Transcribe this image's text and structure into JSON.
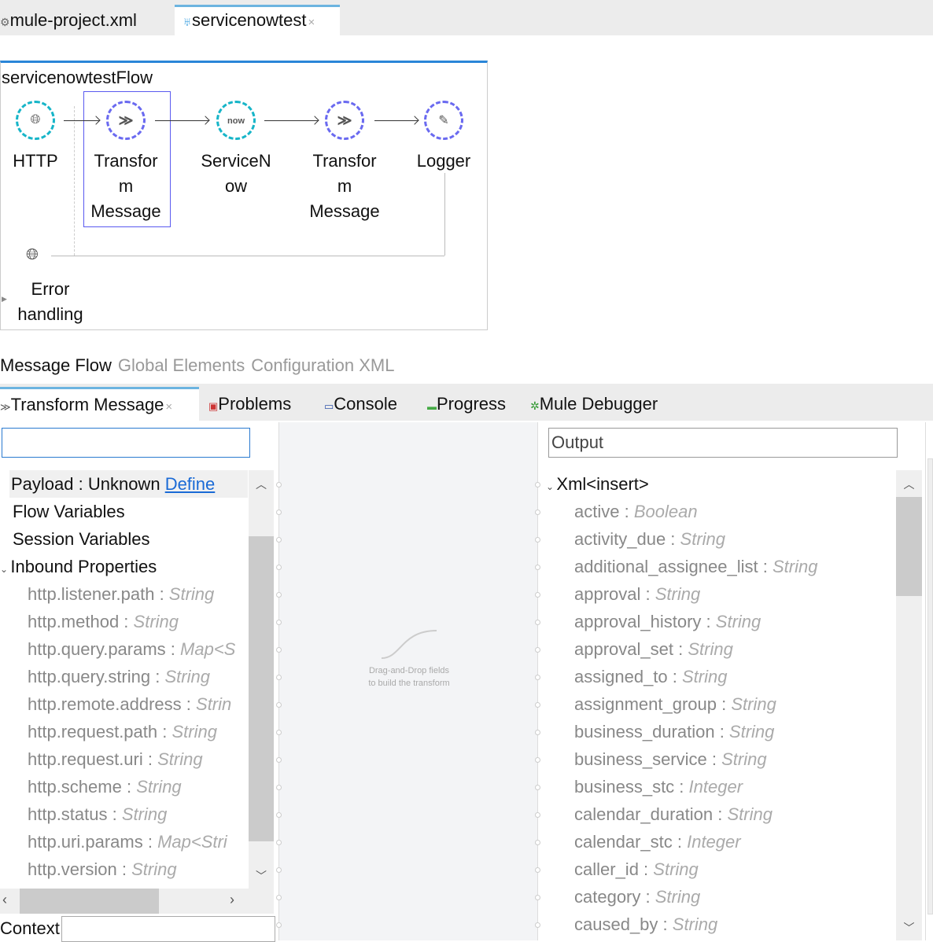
{
  "editor_tabs": [
    {
      "label": "mule-project.xml",
      "icon": "gear-icon"
    },
    {
      "label": "servicenowtest",
      "icon": "mule-icon",
      "close": "×"
    }
  ],
  "flow": {
    "title": "servicenowtestFlow",
    "nodes": [
      {
        "label": "HTTP",
        "icon": "globe-icon",
        "color": "#17b5c8"
      },
      {
        "label": "Transform Message",
        "icon": "dataweave-icon",
        "color": "#6a6af0"
      },
      {
        "label": "ServiceNow",
        "icon": "now",
        "color": "#17b5c8"
      },
      {
        "label": "Transform Message",
        "icon": "dataweave-icon",
        "color": "#6a6af0"
      },
      {
        "label": "Logger",
        "icon": "pencil-icon",
        "color": "#6a6af0"
      }
    ],
    "node_lines": [
      [
        "HTTP"
      ],
      [
        "Transfor",
        "m",
        "Message"
      ],
      [
        "ServiceN",
        "ow"
      ],
      [
        "Transfor",
        "m",
        "Message"
      ],
      [
        "Logger"
      ]
    ],
    "error_handling": [
      "Error",
      "handling"
    ]
  },
  "subtabs": [
    "Message Flow",
    "Global Elements",
    "Configuration XML"
  ],
  "panel_tabs": [
    {
      "label": "Transform Message",
      "close": "×"
    },
    {
      "label": "Problems"
    },
    {
      "label": "Console"
    },
    {
      "label": "Progress"
    },
    {
      "label": "Mule Debugger"
    }
  ],
  "input": {
    "search_value": "",
    "payload": {
      "name": "Payload : Unknown",
      "link": "Define"
    },
    "items": [
      "Flow Variables",
      "Session Variables"
    ],
    "group": "Inbound Properties",
    "properties": [
      [
        "http.listener.path",
        "String"
      ],
      [
        "http.method",
        "String"
      ],
      [
        "http.query.params",
        "Map<S"
      ],
      [
        "http.query.string",
        "String"
      ],
      [
        "http.remote.address",
        "Strin"
      ],
      [
        "http.request.path",
        "String"
      ],
      [
        "http.request.uri",
        "String"
      ],
      [
        "http.scheme",
        "String"
      ],
      [
        "http.status",
        "String"
      ],
      [
        "http.uri.params",
        "Map<Stri"
      ],
      [
        "http.version",
        "String"
      ]
    ],
    "context_label": "Context"
  },
  "mapping": {
    "hint": [
      "Drag-and-Drop fields",
      "to build the transform"
    ]
  },
  "output": {
    "placeholder": "Output",
    "root": "Xml<insert>",
    "fields": [
      [
        "active",
        "Boolean"
      ],
      [
        "activity_due",
        "String"
      ],
      [
        "additional_assignee_list",
        "String"
      ],
      [
        "approval",
        "String"
      ],
      [
        "approval_history",
        "String"
      ],
      [
        "approval_set",
        "String"
      ],
      [
        "assigned_to",
        "String"
      ],
      [
        "assignment_group",
        "String"
      ],
      [
        "business_duration",
        "String"
      ],
      [
        "business_service",
        "String"
      ],
      [
        "business_stc",
        "Integer"
      ],
      [
        "calendar_duration",
        "String"
      ],
      [
        "calendar_stc",
        "Integer"
      ],
      [
        "caller_id",
        "String"
      ],
      [
        "category",
        "String"
      ],
      [
        "caused_by",
        "String"
      ]
    ]
  }
}
